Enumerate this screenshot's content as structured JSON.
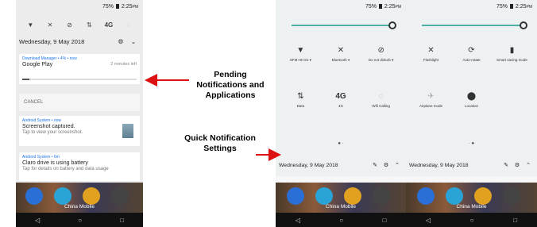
{
  "status": {
    "battery": "75%",
    "time": "2:25",
    "time_suffix": "PM"
  },
  "date": "Wednesday, 9 May 2018",
  "left": {
    "quick_icons": [
      "wifi-icon",
      "bluetooth-icon",
      "dnd-icon",
      "data-icon",
      "4g-icon"
    ],
    "quick_icon_glyphs": [
      "▼",
      "✕",
      "⊘",
      "⇅",
      "4G"
    ],
    "download": {
      "header": "Download Manager • 4% • now",
      "title": "Google Play",
      "status": "2 minutes left",
      "progress": 0.06
    },
    "cancel_label": "CANCEL",
    "screenshot": {
      "header": "Android System • now",
      "title": "Screenshot captured.",
      "sub": "Tap to view your screenshot."
    },
    "battery_notif": {
      "header": "Android System • 6m",
      "title": "Claro drive is using battery",
      "sub": "Tap for details on battery and data usage"
    },
    "carrier": "China Mobile"
  },
  "mid": {
    "tiles": [
      {
        "icon": "▼",
        "label": "SFM HH 81 ▾"
      },
      {
        "icon": "✕",
        "label": "Bluetooth ▾"
      },
      {
        "icon": "⊘",
        "label": "Do not disturb ▾"
      },
      {
        "icon": "⇅",
        "label": "Data"
      },
      {
        "icon": "4G",
        "label": "4G"
      },
      {
        "icon": "◌",
        "label": "Wifi Calling"
      }
    ],
    "carrier": "China Mobile"
  },
  "right": {
    "tiles": [
      {
        "icon": "✕",
        "label": "Flashlight"
      },
      {
        "icon": "⟳",
        "label": "Auto-rotate"
      },
      {
        "icon": "▮",
        "label": "Smart saving mode"
      },
      {
        "icon": "✈",
        "label": "Airplane mode"
      },
      {
        "icon": "⬤",
        "label": "Location"
      }
    ],
    "carrier": "China Mobile"
  },
  "annotations": {
    "pending": "Pending Notifications and Applications",
    "quick": "Quick Notification Settings"
  }
}
